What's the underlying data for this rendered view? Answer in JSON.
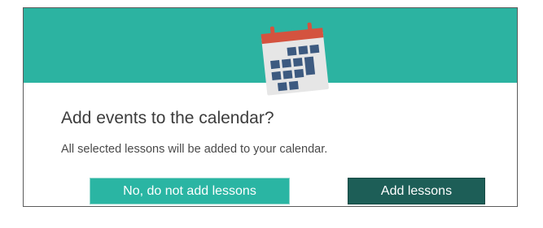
{
  "colors": {
    "accent": "#2cb3a1",
    "primary_button": "#1d5e57",
    "secondary_button": "#2ab5a3",
    "calendar_binding": "#d4533f",
    "calendar_body": "#e8e8e8",
    "calendar_cells": "#3d5a80"
  },
  "dialog": {
    "icon": "calendar-icon",
    "title": "Add events to the calendar?",
    "message": "All selected lessons will be added to your calendar.",
    "buttons": {
      "secondary_label": "No, do not add lessons",
      "primary_label": "Add lessons"
    }
  }
}
